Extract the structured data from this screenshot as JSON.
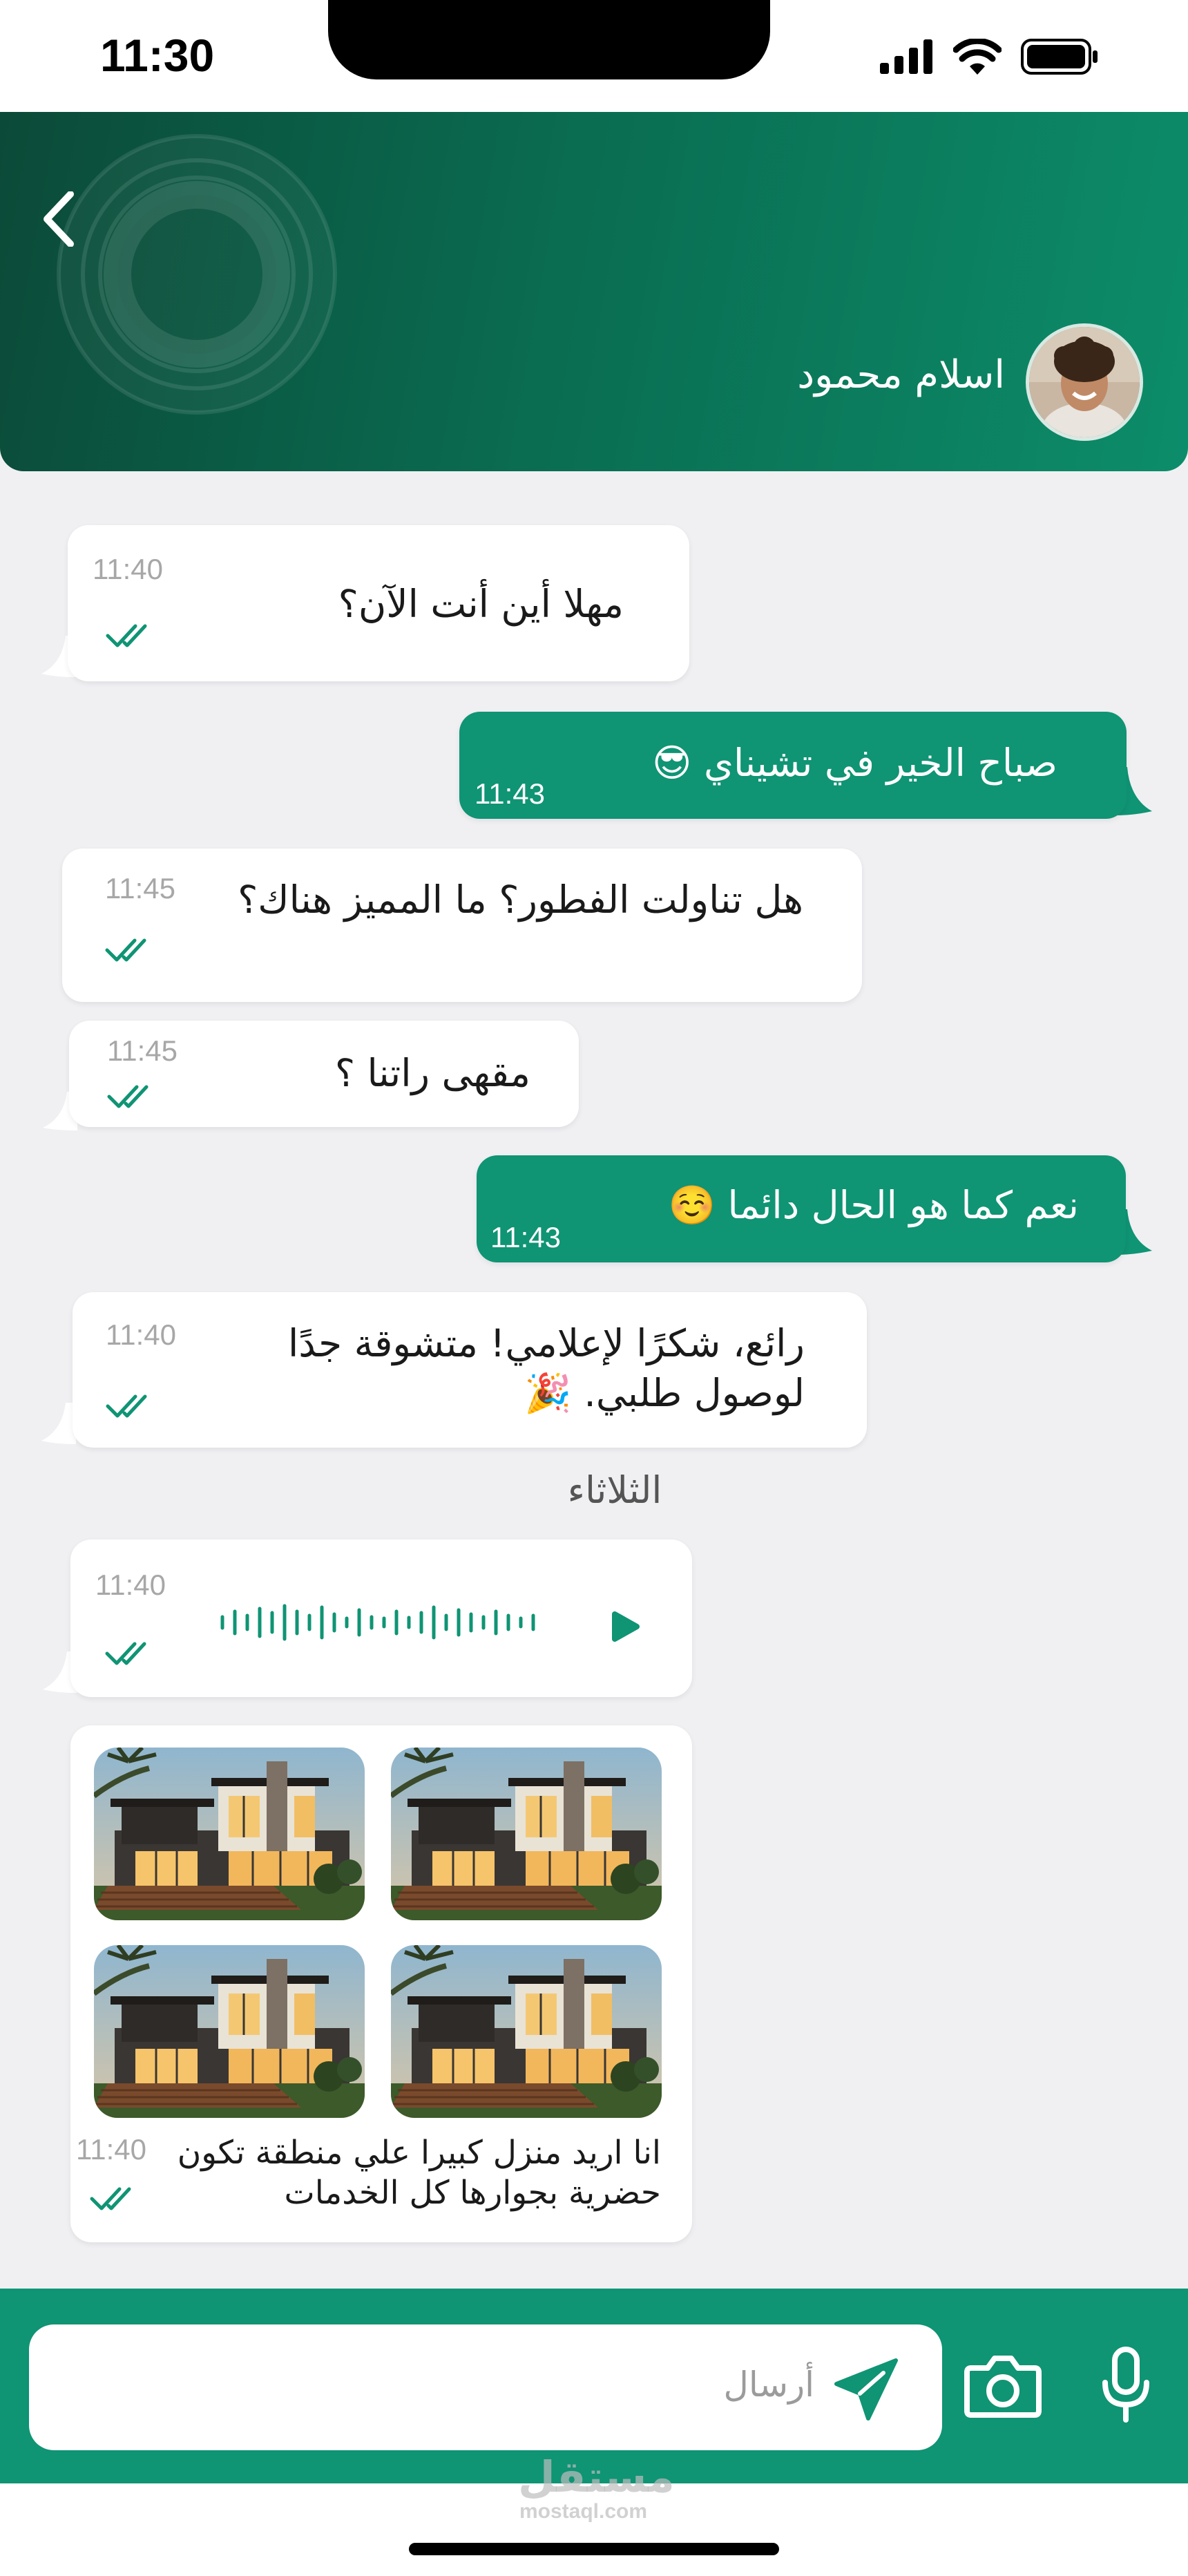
{
  "status_bar": {
    "time": "11:30"
  },
  "header": {
    "contact_name": "اسلام محمود"
  },
  "day_separator": "الثلاثاء",
  "messages": [
    {
      "dir": "in",
      "text": "مهلا أين أنت الآن؟",
      "time": "11:40"
    },
    {
      "dir": "out",
      "text": "صباح الخير في تشيناي 😎",
      "time": "11:43"
    },
    {
      "dir": "in",
      "text": "هل تناولت الفطور؟ ما المميز هناك؟",
      "time": "11:45"
    },
    {
      "dir": "in",
      "text": "مقهى راتنا ؟",
      "time": "11:45"
    },
    {
      "dir": "out",
      "text": "نعم كما هو الحال دائما ☺️",
      "time": "11:43"
    },
    {
      "dir": "in",
      "text": "رائع، شكرًا لإعلامي! متشوقة جدًا لوصول طلبي. 🎉",
      "time": "11:40"
    },
    {
      "dir": "in",
      "type": "voice",
      "time": "11:40"
    },
    {
      "dir": "in",
      "type": "images",
      "text": "انا اريد منزل كبيرا علي منطقة تكون حضرية بجوارها كل الخدمات",
      "time": "11:40"
    }
  ],
  "composer": {
    "placeholder": "أرسال"
  },
  "watermark": {
    "arabic": "مستقل",
    "latin": "mostaql.com"
  },
  "colors": {
    "brand": "#0f9474",
    "header_dark": "#0b4a38",
    "tick": "#0f9474"
  }
}
